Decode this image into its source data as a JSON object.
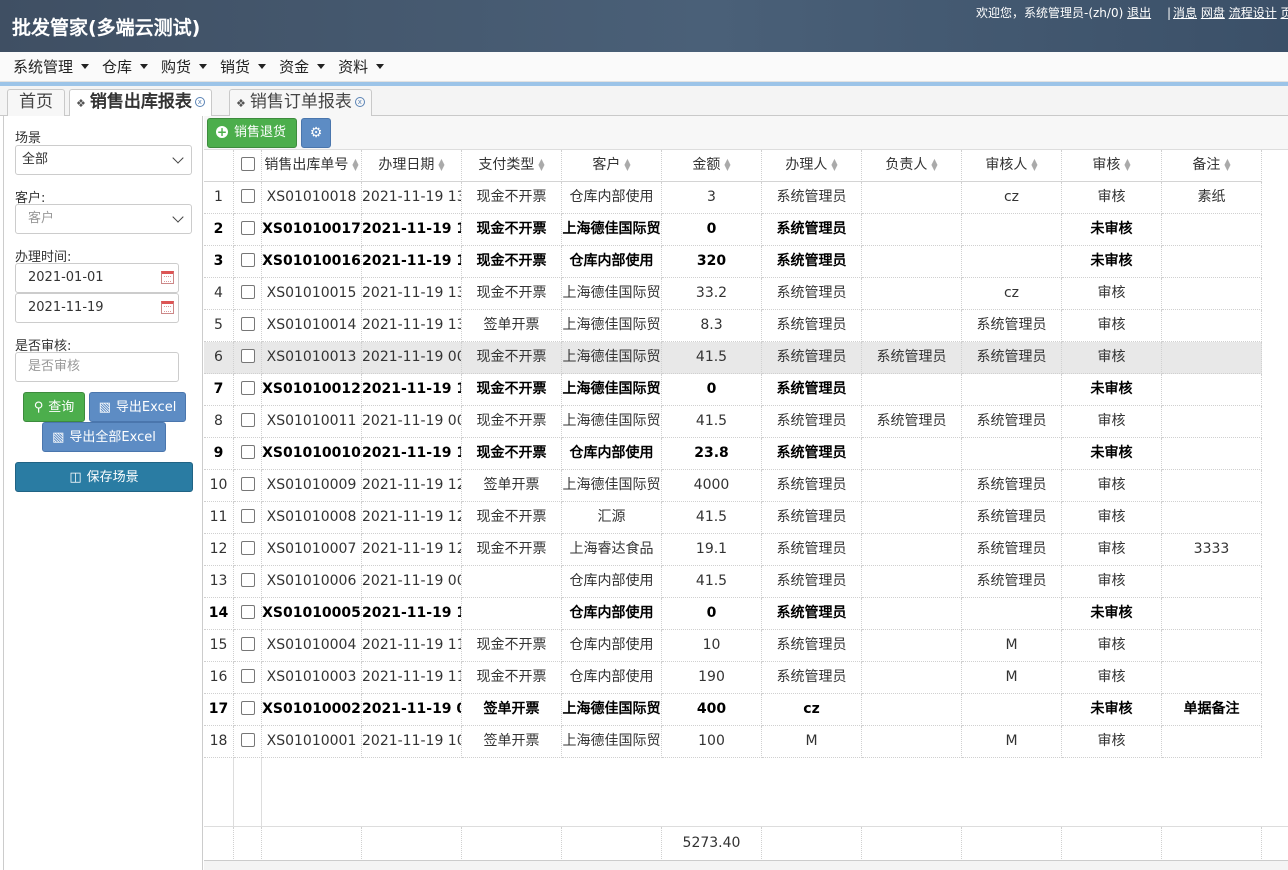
{
  "header": {
    "app_title": "批发管家(多端云测试)",
    "welcome_text": "欢迎您，系统管理员-(zh/0)",
    "logout_link": "退出",
    "links": [
      "消息",
      "网盘",
      "流程设计",
      "页"
    ]
  },
  "menu": [
    {
      "label": "系统管理"
    },
    {
      "label": "仓库"
    },
    {
      "label": "购货"
    },
    {
      "label": "销货"
    },
    {
      "label": "资金"
    },
    {
      "label": "资料"
    }
  ],
  "tabs": [
    {
      "label": "首页"
    },
    {
      "label": "销售出库报表",
      "active": true
    },
    {
      "label": "销售订单报表"
    }
  ],
  "filter": {
    "scene_label": "场景",
    "scene_value": "全部",
    "customer_label": "客户:",
    "customer_placeholder": "客户",
    "date_label": "办理时间:",
    "date_from": "2021-01-01",
    "date_to": "2021-11-19",
    "audit_label": "是否审核:",
    "audit_placeholder": "是否审核",
    "query_button": "查询",
    "export_button": "导出Excel",
    "export_all_button": "导出全部Excel",
    "save_scene_button": "保存场景"
  },
  "toolbar": {
    "return_button": "销售退货",
    "settings_icon": "gears-icon"
  },
  "table": {
    "columns": [
      "销售出库单号",
      "办理日期",
      "支付类型",
      "客户",
      "金额",
      "办理人",
      "负责人",
      "审核人",
      "审核",
      "备注"
    ],
    "rows": [
      {
        "num": "1",
        "no": "XS01010018",
        "date": "2021-11-19 13",
        "pay": "现金不开票",
        "cust": "仓库内部使用",
        "amt": "3",
        "handler": "系统管理员",
        "owner": "",
        "auditor": "cz",
        "audit": "审核",
        "remark": "素纸",
        "bold": false
      },
      {
        "num": "2",
        "no": "XS01010017",
        "date": "2021-11-19 1",
        "pay": "现金不开票",
        "cust": "上海德佳国际贸",
        "amt": "0",
        "handler": "系统管理员",
        "owner": "",
        "auditor": "",
        "audit": "未审核",
        "remark": "",
        "bold": true
      },
      {
        "num": "3",
        "no": "XS01010016",
        "date": "2021-11-19 1",
        "pay": "现金不开票",
        "cust": "仓库内部使用",
        "amt": "320",
        "handler": "系统管理员",
        "owner": "",
        "auditor": "",
        "audit": "未审核",
        "remark": "",
        "bold": true
      },
      {
        "num": "4",
        "no": "XS01010015",
        "date": "2021-11-19 13",
        "pay": "现金不开票",
        "cust": "上海德佳国际贸",
        "amt": "33.2",
        "handler": "系统管理员",
        "owner": "",
        "auditor": "cz",
        "audit": "审核",
        "remark": "",
        "bold": false
      },
      {
        "num": "5",
        "no": "XS01010014",
        "date": "2021-11-19 13",
        "pay": "签单开票",
        "cust": "上海德佳国际贸",
        "amt": "8.3",
        "handler": "系统管理员",
        "owner": "",
        "auditor": "系统管理员",
        "audit": "审核",
        "remark": "",
        "bold": false
      },
      {
        "num": "6",
        "no": "XS01010013",
        "date": "2021-11-19 00",
        "pay": "现金不开票",
        "cust": "上海德佳国际贸",
        "amt": "41.5",
        "handler": "系统管理员",
        "owner": "系统管理员",
        "auditor": "系统管理员",
        "audit": "审核",
        "remark": "",
        "bold": false,
        "selected": true
      },
      {
        "num": "7",
        "no": "XS01010012",
        "date": "2021-11-19 1",
        "pay": "现金不开票",
        "cust": "上海德佳国际贸",
        "amt": "0",
        "handler": "系统管理员",
        "owner": "",
        "auditor": "",
        "audit": "未审核",
        "remark": "",
        "bold": true
      },
      {
        "num": "8",
        "no": "XS01010011",
        "date": "2021-11-19 00",
        "pay": "现金不开票",
        "cust": "上海德佳国际贸",
        "amt": "41.5",
        "handler": "系统管理员",
        "owner": "系统管理员",
        "auditor": "系统管理员",
        "audit": "审核",
        "remark": "",
        "bold": false
      },
      {
        "num": "9",
        "no": "XS01010010",
        "date": "2021-11-19 1",
        "pay": "现金不开票",
        "cust": "仓库内部使用",
        "amt": "23.8",
        "handler": "系统管理员",
        "owner": "",
        "auditor": "",
        "audit": "未审核",
        "remark": "",
        "bold": true
      },
      {
        "num": "10",
        "no": "XS01010009",
        "date": "2021-11-19 12",
        "pay": "签单开票",
        "cust": "上海德佳国际贸",
        "amt": "4000",
        "handler": "系统管理员",
        "owner": "",
        "auditor": "系统管理员",
        "audit": "审核",
        "remark": "",
        "bold": false
      },
      {
        "num": "11",
        "no": "XS01010008",
        "date": "2021-11-19 12",
        "pay": "现金不开票",
        "cust": "汇源",
        "amt": "41.5",
        "handler": "系统管理员",
        "owner": "",
        "auditor": "系统管理员",
        "audit": "审核",
        "remark": "",
        "bold": false
      },
      {
        "num": "12",
        "no": "XS01010007",
        "date": "2021-11-19 12",
        "pay": "现金不开票",
        "cust": "上海睿达食品",
        "amt": "19.1",
        "handler": "系统管理员",
        "owner": "",
        "auditor": "系统管理员",
        "audit": "审核",
        "remark": "3333",
        "bold": false
      },
      {
        "num": "13",
        "no": "XS01010006",
        "date": "2021-11-19 00",
        "pay": "",
        "cust": "仓库内部使用",
        "amt": "41.5",
        "handler": "系统管理员",
        "owner": "",
        "auditor": "系统管理员",
        "audit": "审核",
        "remark": "",
        "bold": false
      },
      {
        "num": "14",
        "no": "XS01010005",
        "date": "2021-11-19 1",
        "pay": "",
        "cust": "仓库内部使用",
        "amt": "0",
        "handler": "系统管理员",
        "owner": "",
        "auditor": "",
        "audit": "未审核",
        "remark": "",
        "bold": true
      },
      {
        "num": "15",
        "no": "XS01010004",
        "date": "2021-11-19 11",
        "pay": "现金不开票",
        "cust": "仓库内部使用",
        "amt": "10",
        "handler": "系统管理员",
        "owner": "",
        "auditor": "M",
        "audit": "审核",
        "remark": "",
        "bold": false
      },
      {
        "num": "16",
        "no": "XS01010003",
        "date": "2021-11-19 11",
        "pay": "现金不开票",
        "cust": "仓库内部使用",
        "amt": "190",
        "handler": "系统管理员",
        "owner": "",
        "auditor": "M",
        "audit": "审核",
        "remark": "",
        "bold": false
      },
      {
        "num": "17",
        "no": "XS01010002",
        "date": "2021-11-19 0",
        "pay": "签单开票",
        "cust": "上海德佳国际贸",
        "amt": "400",
        "handler": "cz",
        "owner": "",
        "auditor": "",
        "audit": "未审核",
        "remark": "单据备注",
        "bold": true
      },
      {
        "num": "18",
        "no": "XS01010001",
        "date": "2021-11-19 10",
        "pay": "签单开票",
        "cust": "上海德佳国际贸",
        "amt": "100",
        "handler": "M",
        "owner": "",
        "auditor": "M",
        "audit": "审核",
        "remark": "",
        "bold": false
      }
    ],
    "total_amount": "5273.40"
  },
  "colors": {
    "header_bg": "#44586f",
    "accent_blue": "#9cc4e8",
    "green_button": "#4cae4c",
    "blue_button": "#5d8cc4",
    "teal_button": "#2a7ca3",
    "selected_row": "#e8e8e8"
  }
}
